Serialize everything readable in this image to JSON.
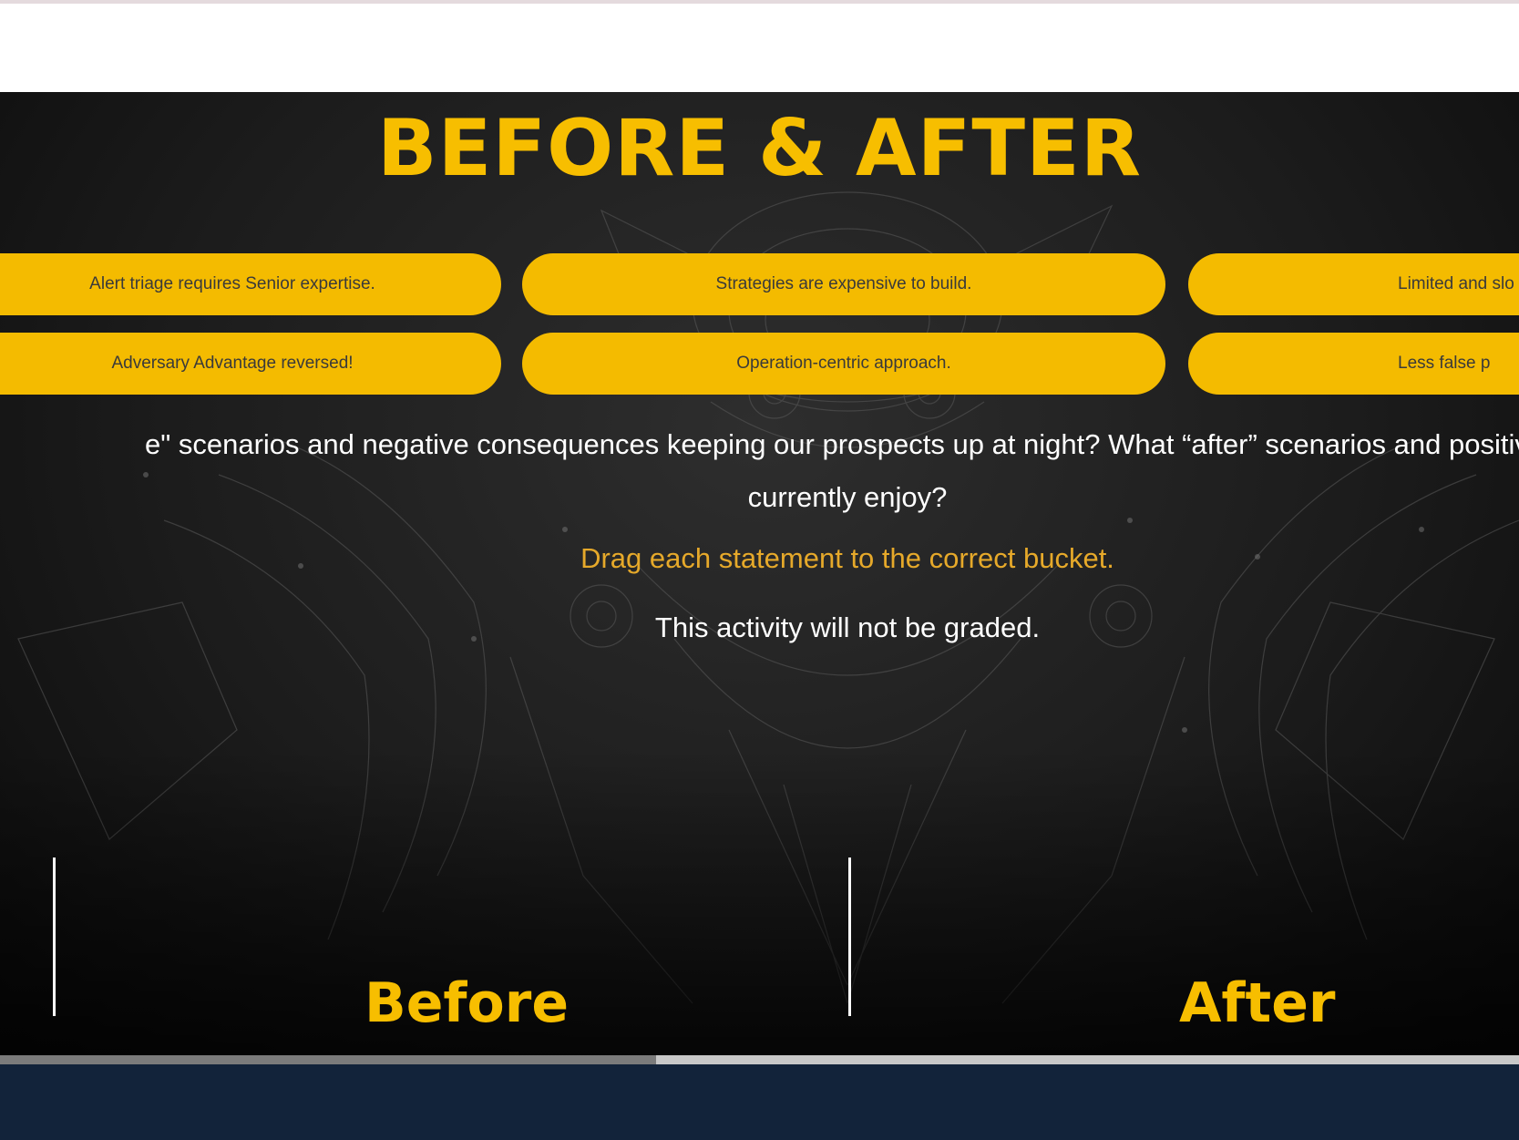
{
  "title": "BEFORE & AFTER",
  "statements": {
    "row1": [
      "Alert triage requires Senior expertise.",
      "Strategies are expensive to build.",
      "Limited and slo"
    ],
    "row2": [
      "Adversary Advantage reversed!",
      "Operation-centric approach.",
      "Less false p"
    ]
  },
  "question_line1": "e\" scenarios and negative consequences keeping our prospects up at night? What “after” scenarios and positive b",
  "question_line2": "currently enjoy?",
  "instruction": "Drag each statement to the correct bucket.",
  "note": "This activity will not be graded.",
  "buckets": {
    "before": "Before",
    "after": "After"
  },
  "colors": {
    "accent": "#f7be00",
    "pill": "#f4bb00",
    "instruction": "#e6a92a",
    "footer": "#12233a"
  },
  "scroll_position": 0.43
}
